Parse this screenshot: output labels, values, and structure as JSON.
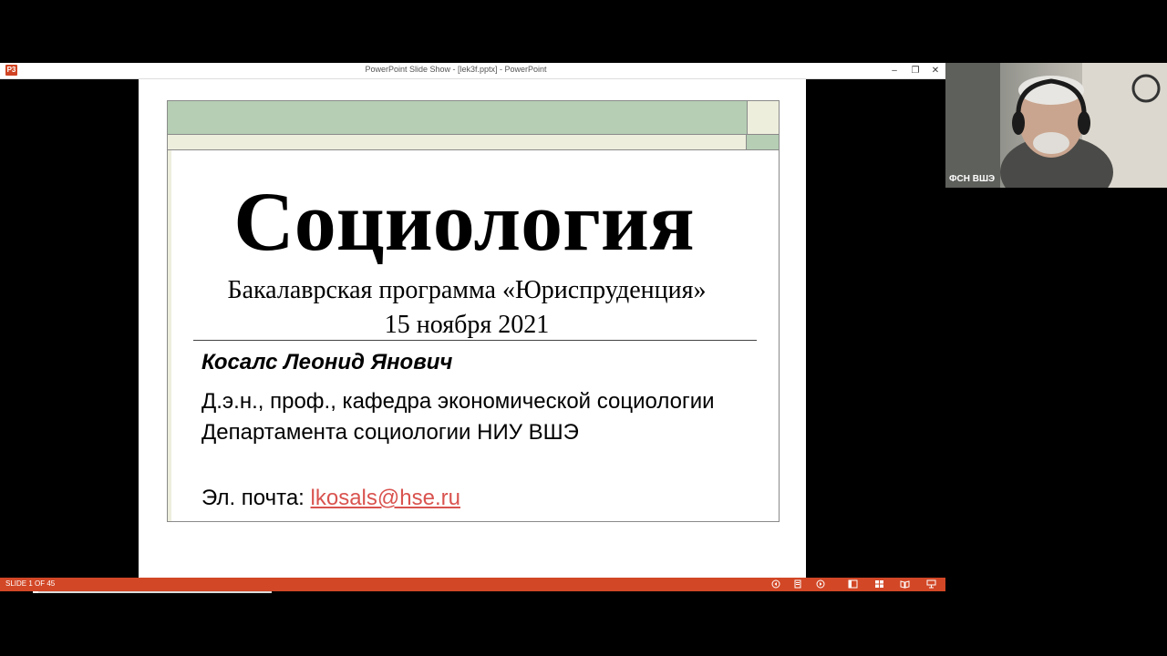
{
  "window": {
    "title": "PowerPoint Slide Show - [lek3f.pptx] - PowerPoint",
    "app_icon_text": "P3",
    "min_icon": "–",
    "max_icon": "❐",
    "close_icon": "✕"
  },
  "slide": {
    "title": "Социология",
    "subtitle_line1": "Бакалаврская программа «Юриспруденция»",
    "subtitle_line2": "15 ноября 2021",
    "author": "Косалс Леонид Янович",
    "affiliation": "Д.э.н., проф., кафедра экономической социологии Департамента социологии НИУ ВШЭ",
    "email_label": "Эл. почта: ",
    "email": "lkosals@hse.ru"
  },
  "statusbar": {
    "slide_counter": "SLIDE 1 OF 45",
    "progress": 0.022,
    "icons": [
      "previous-icon",
      "notes-icon",
      "next-icon",
      "normal-view-icon",
      "slide-sorter-icon",
      "reading-view-icon",
      "slideshow-icon"
    ]
  },
  "webcam": {
    "label": "ФСН ВШЭ"
  },
  "colors": {
    "accent_green": "#b5ceb4",
    "accent_cream": "#eeeedd",
    "statusbar": "#d24726",
    "link": "#d9534f"
  }
}
